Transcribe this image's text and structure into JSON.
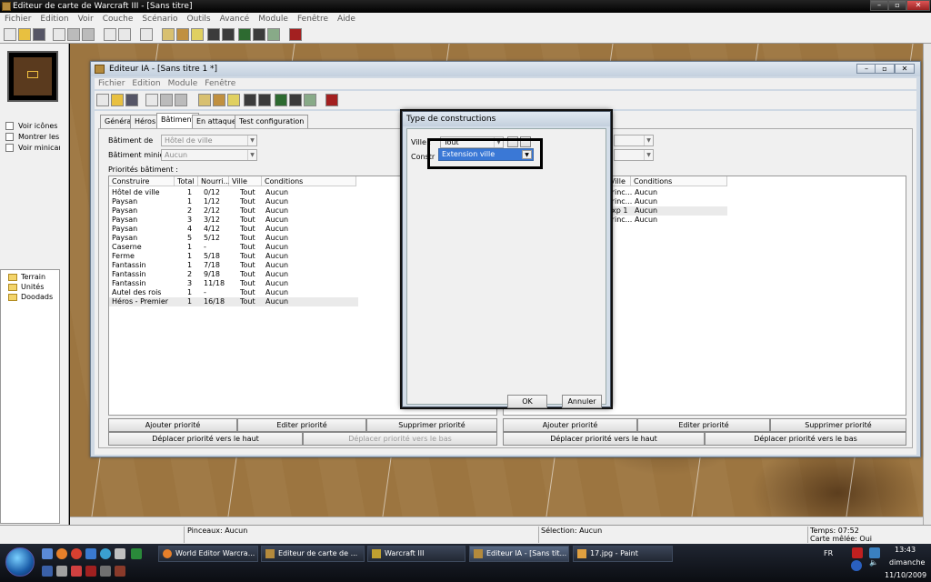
{
  "window": {
    "title": "Editeur de carte de Warcraft III - [Sans titre]"
  },
  "menu": [
    "Fichier",
    "Edition",
    "Voir",
    "Couche",
    "Scénario",
    "Outils",
    "Avancé",
    "Module",
    "Fenêtre",
    "Aide"
  ],
  "left_panel": {
    "checkboxes": [
      "Voir icônes b",
      "Montrer les ic",
      "Voir minicarte"
    ],
    "tree": [
      "Terrain",
      "Unités",
      "Doodads"
    ]
  },
  "status": {
    "brush": "Pinceaux: Aucun",
    "selection": "Sélection: Aucun",
    "time": "Temps: 07:52",
    "map_type": "Carte mêlée: Oui"
  },
  "ia_editor": {
    "title": "Editeur IA - [Sans titre 1 *]",
    "menu": [
      "Fichier",
      "Edition",
      "Module",
      "Fenêtre"
    ],
    "tabs": [
      "Général",
      "Héros",
      "Bâtiment",
      "En attaque",
      "Test configuration"
    ],
    "active_tab": "Bâtiment",
    "batiment_de_label": "Bâtiment de",
    "batiment_de_value": "Hôtel de ville",
    "batiment_minier_label": "Bâtiment minier :",
    "batiment_minier_value": "Aucun",
    "priorities_label": "Priorités bâtiment :",
    "columns": [
      "Construire",
      "Total",
      "Nourri...",
      "Ville",
      "Conditions"
    ],
    "rows": [
      [
        "Hôtel de ville",
        "1",
        "0/12",
        "Tout",
        "Aucun"
      ],
      [
        "Paysan",
        "1",
        "1/12",
        "Tout",
        "Aucun"
      ],
      [
        "Paysan",
        "2",
        "2/12",
        "Tout",
        "Aucun"
      ],
      [
        "Paysan",
        "3",
        "3/12",
        "Tout",
        "Aucun"
      ],
      [
        "Paysan",
        "4",
        "4/12",
        "Tout",
        "Aucun"
      ],
      [
        "Paysan",
        "5",
        "5/12",
        "Tout",
        "Aucun"
      ],
      [
        "Caserne",
        "1",
        "-",
        "Tout",
        "Aucun"
      ],
      [
        "Ferme",
        "1",
        "5/18",
        "Tout",
        "Aucun"
      ],
      [
        "Fantassin",
        "1",
        "7/18",
        "Tout",
        "Aucun"
      ],
      [
        "Fantassin",
        "2",
        "9/18",
        "Tout",
        "Aucun"
      ],
      [
        "Fantassin",
        "3",
        "11/18",
        "Tout",
        "Aucun"
      ],
      [
        "Autel des rois",
        "1",
        "-",
        "Tout",
        "Aucun"
      ],
      [
        "Héros - Premier",
        "1",
        "16/18",
        "Tout",
        "Aucun"
      ]
    ],
    "right_columns": [
      "Ville",
      "Conditions"
    ],
    "right_rows": [
      [
        "Princ...",
        "Aucun"
      ],
      [
        "Princ...",
        "Aucun"
      ],
      [
        "Exp 1",
        "Aucun"
      ],
      [
        "Princ...",
        "Aucun"
      ]
    ],
    "buttons_left": [
      "Ajouter priorité",
      "Editer priorité",
      "Supprimer priorité"
    ],
    "move_left": [
      "Déplacer priorité vers le haut",
      "Déplacer priorité vers le bas"
    ],
    "buttons_right": [
      "Ajouter priorité",
      "Editer priorité",
      "Supprimer priorité"
    ],
    "move_right": [
      "Déplacer priorité vers le haut",
      "Déplacer priorité vers le bas"
    ]
  },
  "dialog": {
    "title": "Type de constructions",
    "ville_label": "Ville :",
    "ville_value": "Tout",
    "construct_label": "Constr",
    "construct_value": "Extension ville",
    "ok": "OK",
    "cancel": "Annuler"
  },
  "taskbar": {
    "tasks": [
      "World Editor Warcra...",
      "Editeur de carte de ...",
      "Warcraft III",
      "Editeur IA - [Sans tit...",
      "17.jpg - Paint"
    ],
    "lang": "FR",
    "time": "13:43",
    "day": "dimanche",
    "date": "11/10/2009"
  }
}
